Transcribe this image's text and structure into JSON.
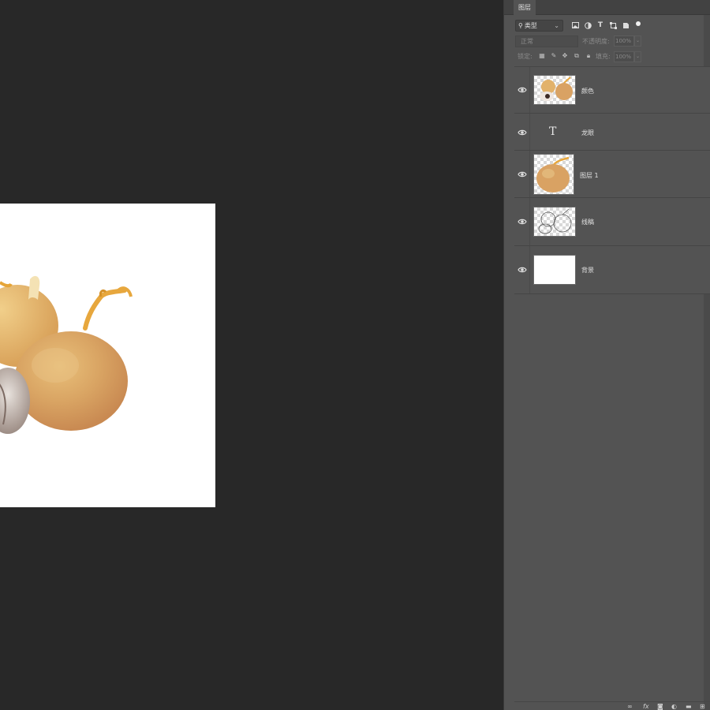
{
  "panel": {
    "tab_label": "图层",
    "filter": {
      "selected": "类型",
      "search_icon": "search-icon",
      "chevron": "⌄"
    },
    "filter_icons": [
      "image-filter-icon",
      "adjustment-filter-icon",
      "type-filter-icon",
      "shape-filter-icon",
      "smart-object-filter-icon",
      "toggle-filter-icon"
    ],
    "blend_mode": "正常",
    "opacity_label": "不透明度:",
    "opacity_value": "100%",
    "lock_label": "锁定:",
    "fill_label": "填充:",
    "fill_value": "100%",
    "dropdown_chev": "⌄"
  },
  "layers": [
    {
      "name": "颜色",
      "kind": "image"
    },
    {
      "name": "龙眼",
      "kind": "type",
      "glyph": "T"
    },
    {
      "name": "图层 1",
      "kind": "image"
    },
    {
      "name": "线稿",
      "kind": "image"
    },
    {
      "name": "背景",
      "kind": "background"
    }
  ],
  "footer_icons": [
    "link-layers-icon",
    "fx-icon",
    "mask-icon",
    "adjustment-icon",
    "group-folder-icon",
    "new-layer-icon"
  ],
  "footer_fx": "fx",
  "colors": {
    "canvas_bg": "#282828",
    "panel_bg": "#535353",
    "document": "#ffffff"
  }
}
